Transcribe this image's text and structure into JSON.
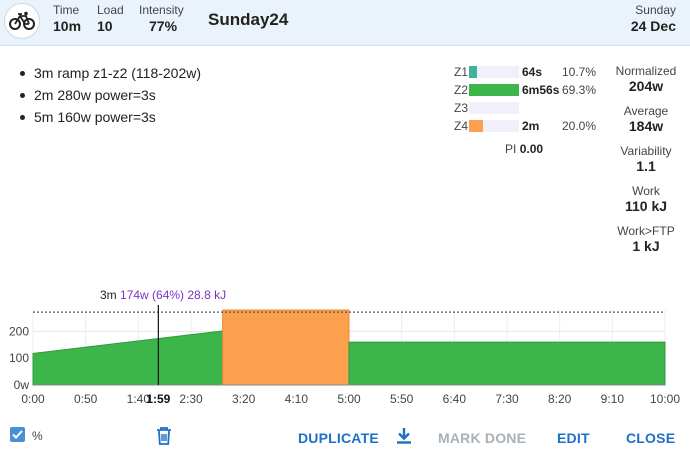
{
  "header": {
    "avatar_icon": "bicycle-icon",
    "stats": [
      {
        "label": "Time",
        "value": "10m"
      },
      {
        "label": "Load",
        "value": "10"
      },
      {
        "label": "Intensity",
        "value": "77%"
      }
    ],
    "title": "Sunday24",
    "day_of_week": "Sunday",
    "date": "24 Dec"
  },
  "steps": [
    "3m ramp z1-z2 (118-202w)",
    "2m 280w power=3s",
    "5m 160w power=3s"
  ],
  "zones": [
    {
      "name": "Z1",
      "time": "64s",
      "percent": "10.7%",
      "fraction": 0.107,
      "color": "#3fb39a"
    },
    {
      "name": "Z2",
      "time": "6m56s",
      "percent": "69.3%",
      "fraction": 0.693,
      "color": "#3cb54a"
    },
    {
      "name": "Z3",
      "time": "",
      "percent": "",
      "fraction": 0,
      "color": "#e3c33a"
    },
    {
      "name": "Z4",
      "time": "2m",
      "percent": "20.0%",
      "fraction": 0.2,
      "color": "#fba04c"
    }
  ],
  "pi": {
    "label": "PI",
    "value": "0.00"
  },
  "metrics": [
    {
      "label": "Normalized",
      "value": "204w"
    },
    {
      "label": "Average",
      "value": "184w"
    },
    {
      "label": "Variability",
      "value": "1.1"
    },
    {
      "label": "Work",
      "value": "110 kJ"
    },
    {
      "label": "Work>FTP",
      "value": "1 kJ"
    }
  ],
  "cursor": {
    "duration": "3m",
    "detail": "174w (64%) 28.8 kJ",
    "time_label": "1:59",
    "time_s": 119
  },
  "chart_data": {
    "type": "area",
    "ylim": [
      0,
      280
    ],
    "yticks": [
      "0w",
      "100",
      "200"
    ],
    "ytick_values": [
      0,
      100,
      200
    ],
    "ftp_line_value": 272,
    "xlim_s": [
      0,
      600
    ],
    "xticks": [
      "0:00",
      "0:50",
      "1:40",
      "2:30",
      "3:20",
      "4:10",
      "5:00",
      "5:50",
      "6:40",
      "7:30",
      "8:20",
      "9:10",
      "10:00"
    ],
    "xtick_values_s": [
      0,
      50,
      100,
      150,
      200,
      250,
      300,
      350,
      400,
      450,
      500,
      550,
      600
    ],
    "segments": [
      {
        "start_s": 0,
        "end_s": 180,
        "start_w": 118,
        "end_w": 202,
        "color": "#3cb54a"
      },
      {
        "start_s": 180,
        "end_s": 300,
        "start_w": 280,
        "end_w": 280,
        "color": "#fba04c"
      },
      {
        "start_s": 300,
        "end_s": 600,
        "start_w": 160,
        "end_w": 160,
        "color": "#3cb54a"
      }
    ]
  },
  "footer": {
    "percent_checkbox_label": "%",
    "duplicate_label": "DUPLICATE",
    "mark_done_label": "MARK DONE",
    "edit_label": "EDIT",
    "close_label": "CLOSE"
  }
}
